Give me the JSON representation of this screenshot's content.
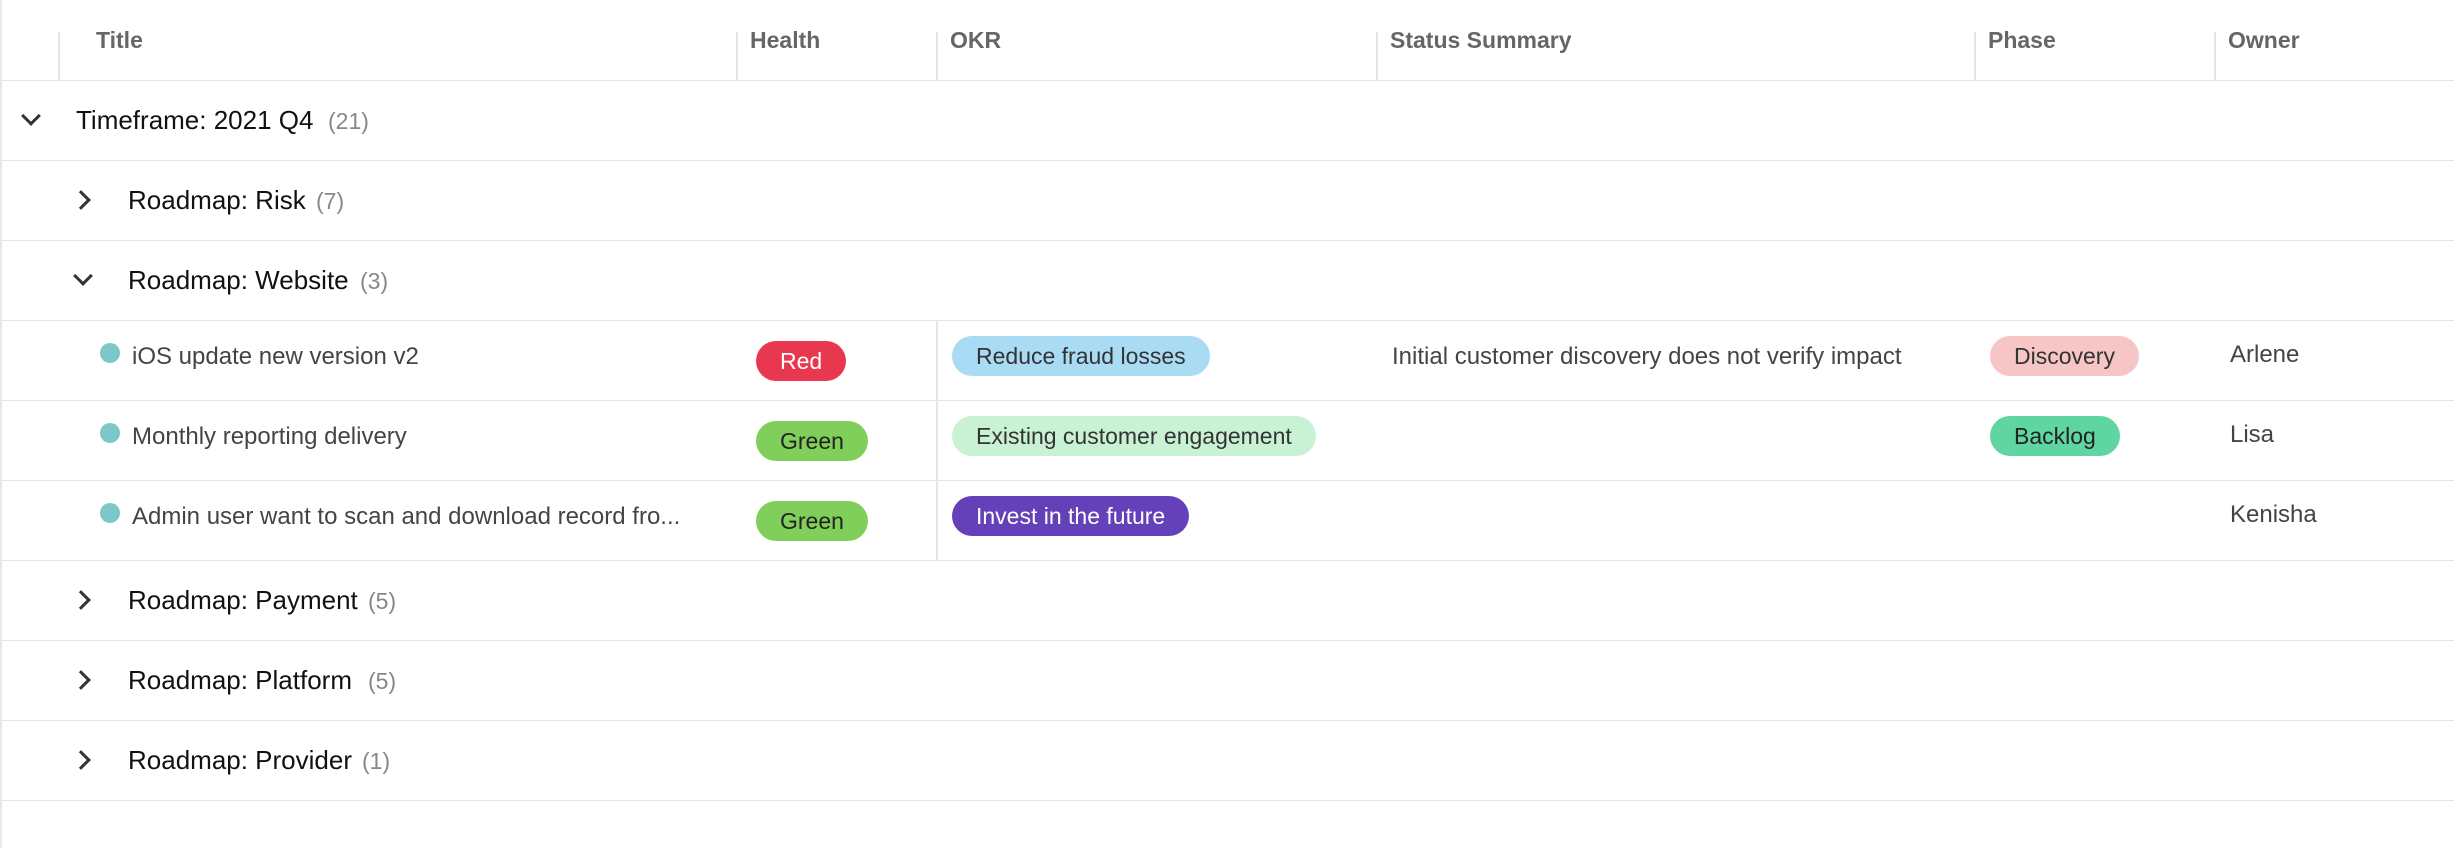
{
  "columns": {
    "title": "Title",
    "health": "Health",
    "okr": "OKR",
    "status_summary": "Status Summary",
    "phase": "Phase",
    "owner": "Owner"
  },
  "timeframe_group": {
    "label": "Timeframe: 2021 Q4",
    "count": "(21)",
    "expanded": true
  },
  "roadmap_groups": [
    {
      "label": "Roadmap: Risk",
      "count": "(7)",
      "expanded": false
    },
    {
      "label": "Roadmap: Website",
      "count": "(3)",
      "expanded": true
    },
    {
      "label": "Roadmap: Payment",
      "count": "(5)",
      "expanded": false
    },
    {
      "label": "Roadmap: Platform",
      "count": "(5)",
      "expanded": false
    },
    {
      "label": "Roadmap: Provider",
      "count": "(1)",
      "expanded": false
    }
  ],
  "items": [
    {
      "title": "iOS update new version v2",
      "health": "Red",
      "okr": "Reduce fraud losses",
      "status_summary": "Initial customer discovery does not verify impact",
      "phase": "Discovery",
      "owner": "Arlene"
    },
    {
      "title": "Monthly reporting delivery",
      "health": "Green",
      "okr": "Existing customer engagement",
      "status_summary": "",
      "phase": "Backlog",
      "owner": "Lisa"
    },
    {
      "title": "Admin user want to scan and download record fro...",
      "health": "Green",
      "okr": "Invest in the future",
      "status_summary": "",
      "phase": "",
      "owner": "Kenisha"
    }
  ],
  "colors": {
    "health_red": "#e8384f",
    "health_green": "#7fcf5a",
    "okr_blue_bg": "#a9dcf4",
    "okr_green_bg": "#c9f2d4",
    "okr_purple_bg": "#6441b8",
    "phase_discovery_bg": "#f6c6c6",
    "phase_backlog_bg": "#5fd6a2",
    "item_dot": "#7cc8c8"
  }
}
